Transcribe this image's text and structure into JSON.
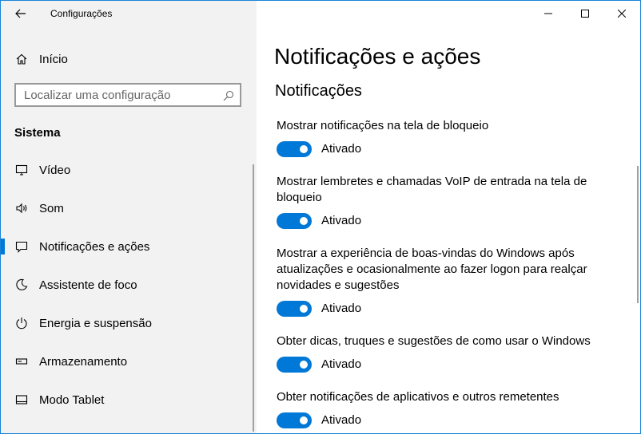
{
  "window": {
    "title": "Configurações",
    "accent_color": "#0078d7",
    "border_color": "#1883d7"
  },
  "sidebar": {
    "home_label": "Início",
    "search_placeholder": "Localizar uma configuração",
    "section_title": "Sistema",
    "items": [
      {
        "label": "Vídeo",
        "icon": "monitor-icon"
      },
      {
        "label": "Som",
        "icon": "speaker-icon"
      },
      {
        "label": "Notificações e ações",
        "icon": "notification-icon",
        "selected": true
      },
      {
        "label": "Assistente de foco",
        "icon": "moon-icon"
      },
      {
        "label": "Energia e suspensão",
        "icon": "power-icon"
      },
      {
        "label": "Armazenamento",
        "icon": "storage-icon"
      },
      {
        "label": "Modo Tablet",
        "icon": "tablet-icon"
      }
    ]
  },
  "main": {
    "page_title": "Notificações e ações",
    "group_title": "Notificações",
    "settings": [
      {
        "description": "Mostrar notificações na tela de bloqueio",
        "state": "Ativado",
        "on": true
      },
      {
        "description": "Mostrar lembretes e chamadas VoIP de entrada na tela de bloqueio",
        "state": "Ativado",
        "on": true
      },
      {
        "description": "Mostrar a experiência de boas-vindas do Windows após atualizações e ocasionalmente ao fazer logon para realçar novidades e sugestões",
        "state": "Ativado",
        "on": true
      },
      {
        "description": "Obter dicas, truques e sugestões de como usar o Windows",
        "state": "Ativado",
        "on": true
      },
      {
        "description": "Obter notificações de aplicativos e outros remetentes",
        "state": "Ativado",
        "on": true
      }
    ]
  }
}
